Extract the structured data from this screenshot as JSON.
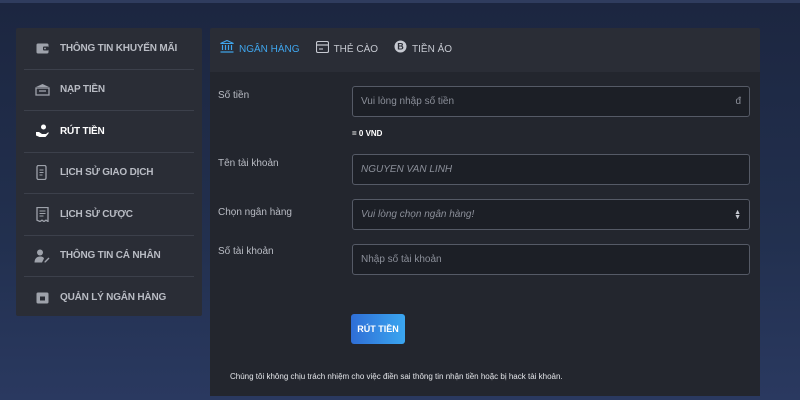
{
  "sidebar": {
    "items": [
      {
        "label": "THÔNG TIN KHUYẾN MÃI",
        "icon": "wallet-icon"
      },
      {
        "label": "NẠP TIỀN",
        "icon": "deposit-icon"
      },
      {
        "label": "RÚT TIỀN",
        "icon": "withdraw-icon"
      },
      {
        "label": "LỊCH SỬ GIAO DỊCH",
        "icon": "phone-history-icon"
      },
      {
        "label": "LỊCH SỬ CƯỢC",
        "icon": "receipt-icon"
      },
      {
        "label": "THÔNG TIN CÁ NHÂN",
        "icon": "user-edit-icon"
      },
      {
        "label": "QUẢN LÝ NGÂN HÀNG",
        "icon": "bank-card-icon"
      }
    ],
    "active_index": 2
  },
  "tabs": [
    {
      "label": "NGÂN HÀNG",
      "icon": "bank-icon"
    },
    {
      "label": "THẺ CÀO",
      "icon": "card-icon"
    },
    {
      "label": "TIỀN ẢO",
      "icon": "bitcoin-icon"
    }
  ],
  "form": {
    "amount": {
      "label": "Số tiền",
      "placeholder": "Vui lòng nhập số tiền",
      "suffix": "đ"
    },
    "amount_note": "= 0 VND",
    "account_name": {
      "label": "Tên tài khoản",
      "placeholder": "NGUYEN VAN LINH"
    },
    "bank": {
      "label": "Chọn ngân hàng",
      "placeholder": "Vui lòng chọn ngân hàng!"
    },
    "account_number": {
      "label": "Số tài khoản",
      "placeholder": "Nhập số tài khoản"
    },
    "submit_label": "RÚT TIỀN",
    "disclaimer": "Chúng tôi không chịu trách nhiệm cho việc điền sai thông tin nhận tiền hoặc bị hack tài khoản."
  },
  "colors": {
    "accent": "#3fa6ee",
    "panel": "#2a2d36",
    "background": "#22304f"
  }
}
